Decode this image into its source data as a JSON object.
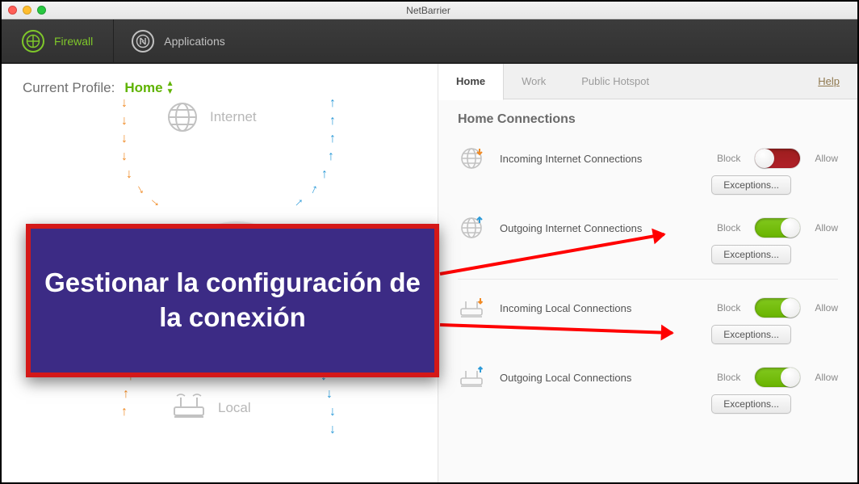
{
  "window": {
    "title": "NetBarrier"
  },
  "toolbar": {
    "firewall": "Firewall",
    "applications": "Applications"
  },
  "left": {
    "profile_label": "Current Profile:",
    "profile_value": "Home",
    "internet_label": "Internet",
    "local_label": "Local"
  },
  "right": {
    "tabs": {
      "home": "Home",
      "work": "Work",
      "public": "Public Hotspot"
    },
    "help": "Help",
    "section_title": "Home Connections",
    "block": "Block",
    "allow": "Allow",
    "exceptions": "Exceptions...",
    "rows": {
      "in_net": "Incoming Internet Connections",
      "out_net": "Outgoing Internet Connections",
      "in_local": "Incoming Local Connections",
      "out_local": "Outgoing Local Connections"
    }
  },
  "annotation": {
    "text": "Gestionar la configuración de la conexión"
  }
}
